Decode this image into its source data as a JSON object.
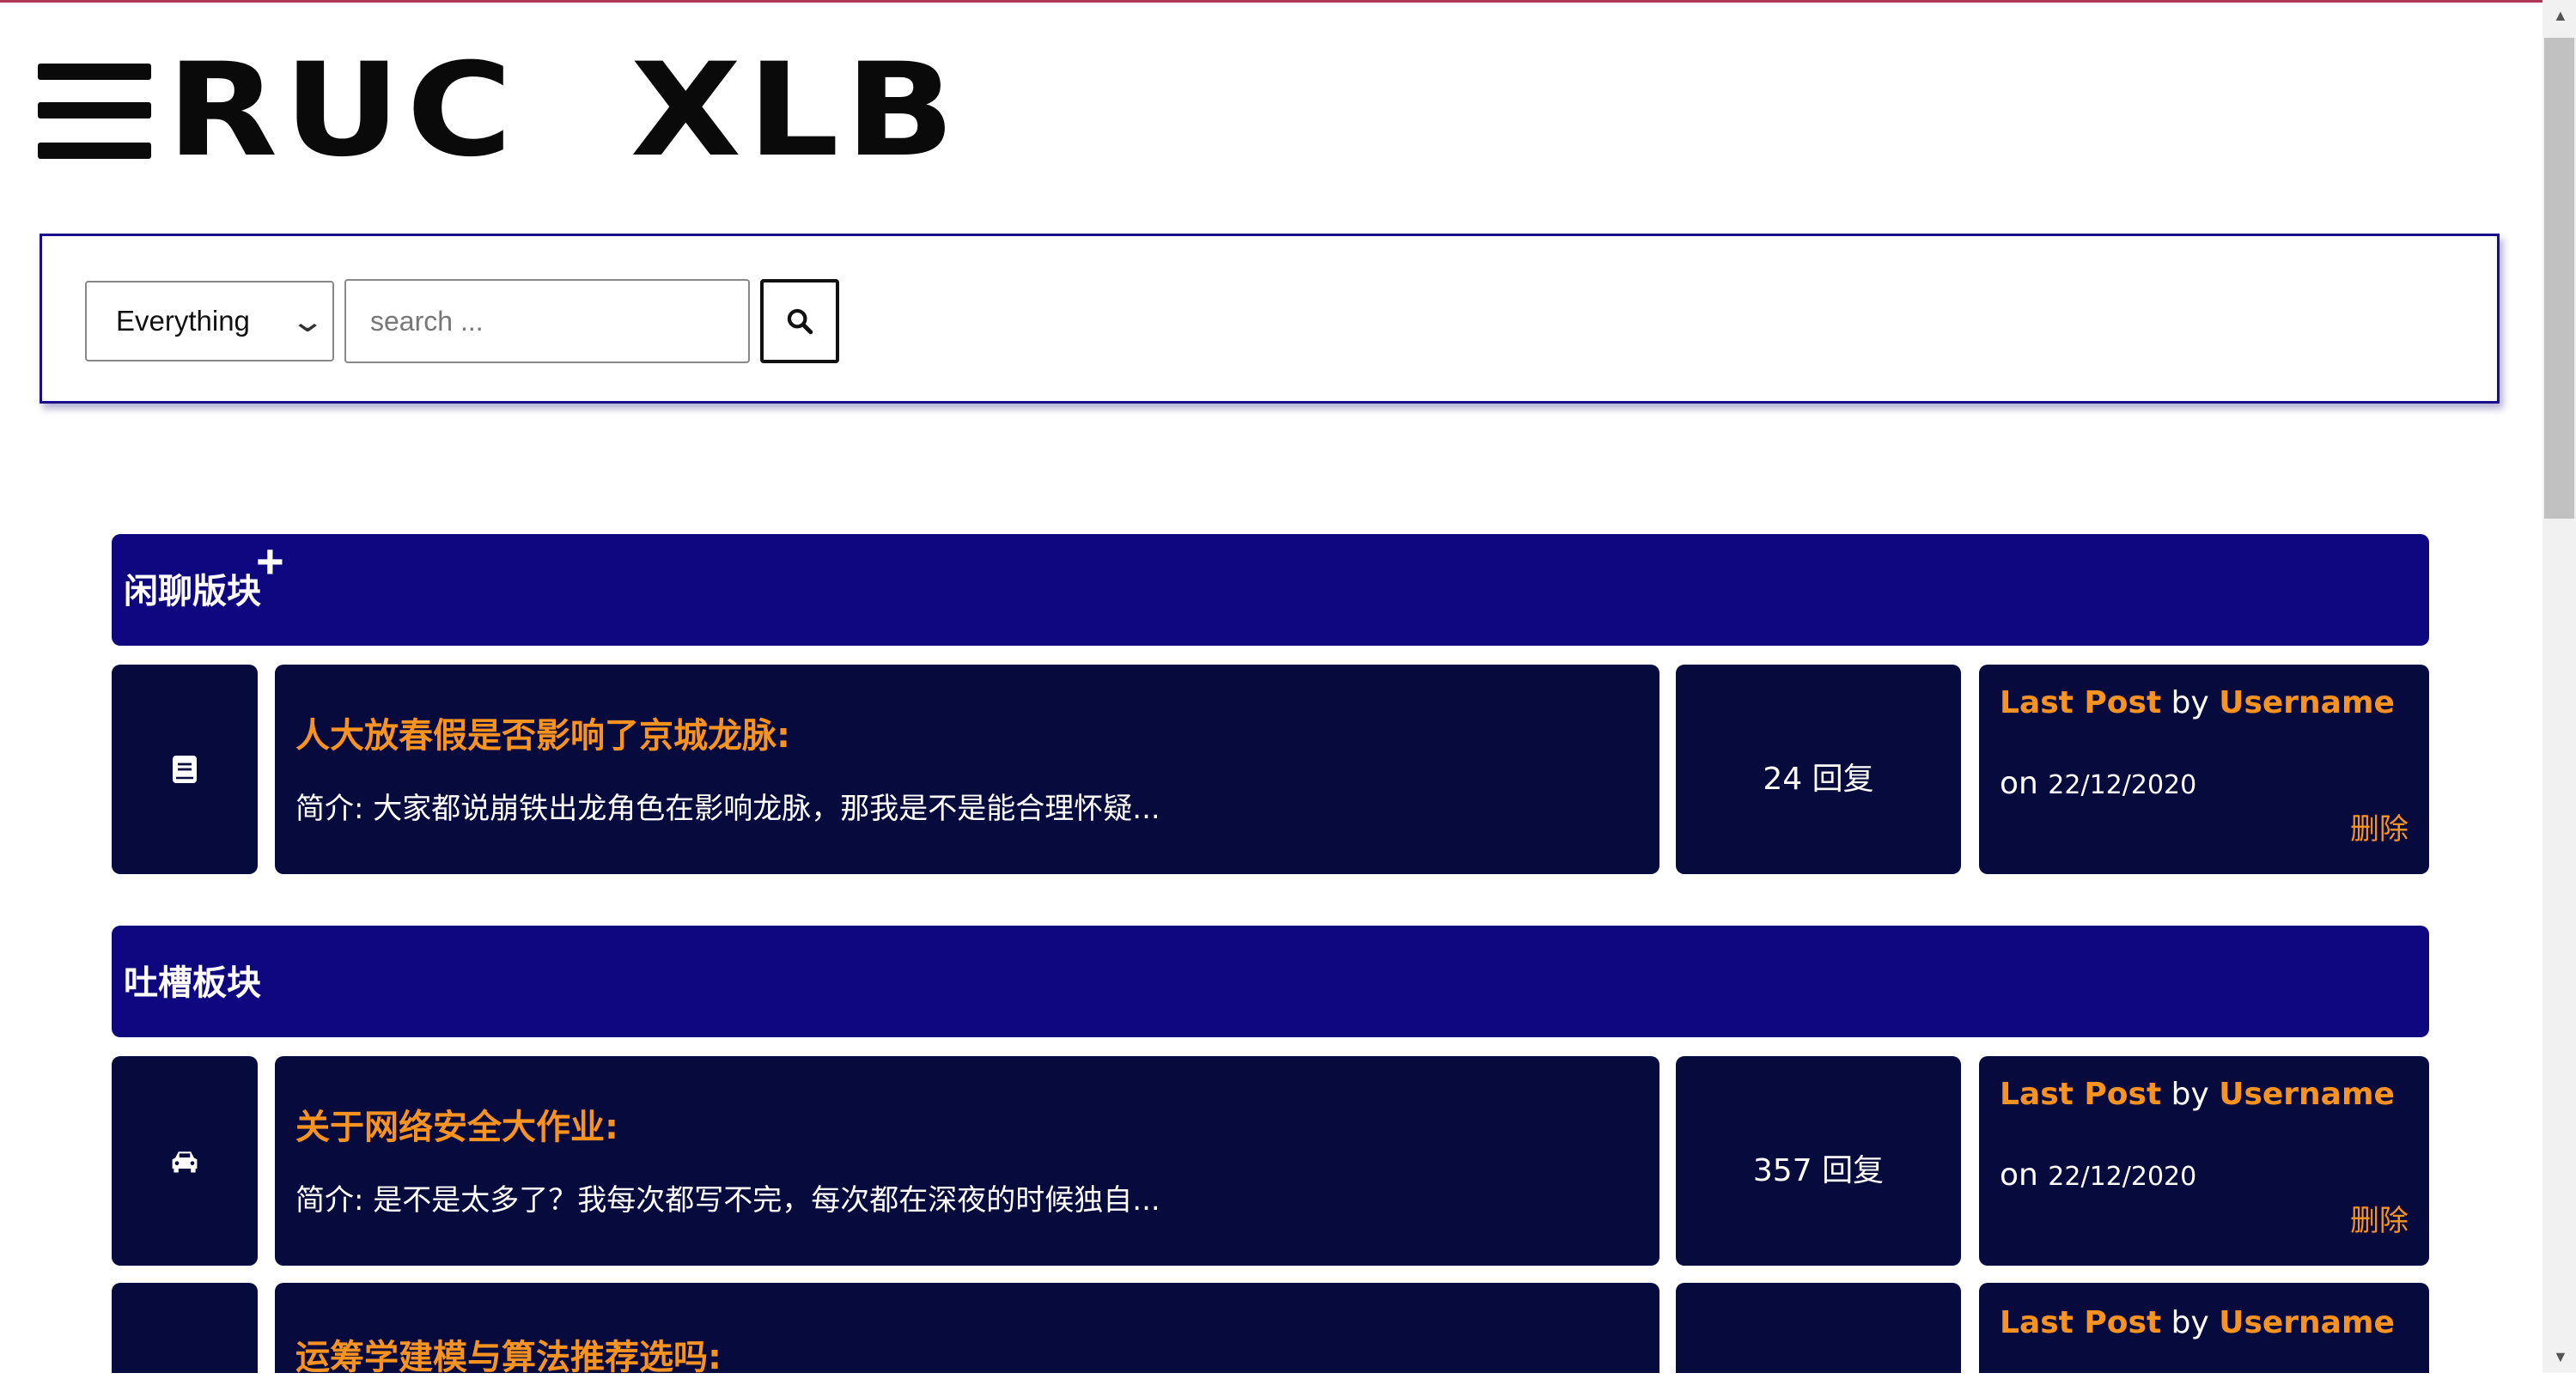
{
  "header": {
    "logo_text": "RUC  XLB",
    "menu_icon": "hamburger-menu-icon"
  },
  "search": {
    "scope_selected": "Everything",
    "placeholder": "search ...",
    "button_icon": "search-icon"
  },
  "sections": [
    {
      "title": "闲聊版块",
      "add_icon": "plus-icon",
      "topics": [
        {
          "icon": "book-icon",
          "title": "人大放春假是否影响了京城龙脉:",
          "desc": "简介: 大家都说崩铁出龙角色在影响龙脉，那我是不是能合理怀疑...",
          "replies": "24 回复",
          "last_post_label": "Last Post",
          "by": "by",
          "username": "Username",
          "on": "on",
          "date": "22/12/2020",
          "delete": "删除"
        }
      ]
    },
    {
      "title": "吐槽板块",
      "topics": [
        {
          "icon": "car-icon",
          "title": "关于网络安全大作业:",
          "desc": "简介: 是不是太多了？我每次都写不完，每次都在深夜的时候独自...",
          "replies": "357 回复",
          "last_post_label": "Last Post",
          "by": "by",
          "username": "Username",
          "on": "on",
          "date": "22/12/2020",
          "delete": "删除"
        },
        {
          "title": "运筹学建模与算法推荐选吗:",
          "last_post_label": "Last Post",
          "by": "by",
          "username": "Username"
        }
      ]
    }
  ],
  "colors": {
    "section_bar": "#0f0780",
    "card": "#060a3d",
    "accent": "#f7931e",
    "search_border": "#1a0f8a"
  }
}
